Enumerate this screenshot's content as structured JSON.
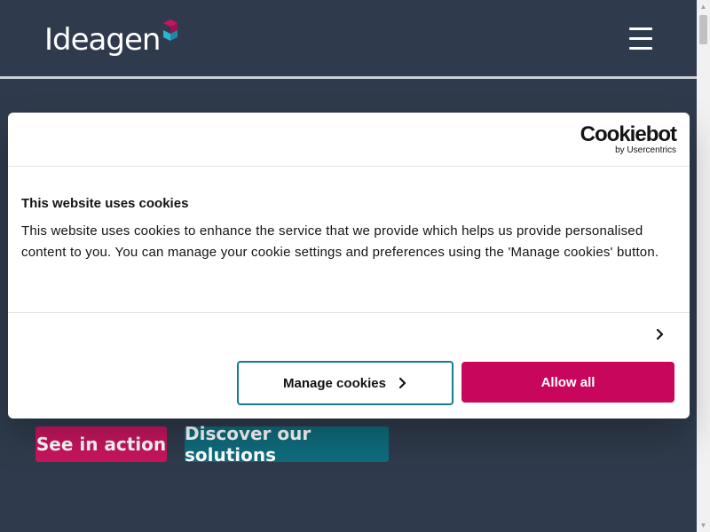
{
  "brand": {
    "logo_text": "Ideagen",
    "colors": {
      "navy": "#2f3b4c",
      "magenta": "#c8155e",
      "teal": "#0f6c7d",
      "cyan_accent": "#2bb3d1"
    }
  },
  "header": {
    "menu_icon": "hamburger-menu-icon"
  },
  "hero": {
    "see_in_action_label": "See in action",
    "discover_label": "Discover our solutions"
  },
  "cookie_dialog": {
    "provider_name": "Cookiebot",
    "provider_sub": "by Usercentrics",
    "title": "This website uses cookies",
    "body": "This website uses cookies to enhance the service that we provide which helps us provide personalised content to you. You can manage your cookie settings and preferences using the 'Manage cookies' button.",
    "expand_icon": "chevron-right-icon",
    "manage_label": "Manage cookies",
    "allow_label": "Allow all"
  }
}
